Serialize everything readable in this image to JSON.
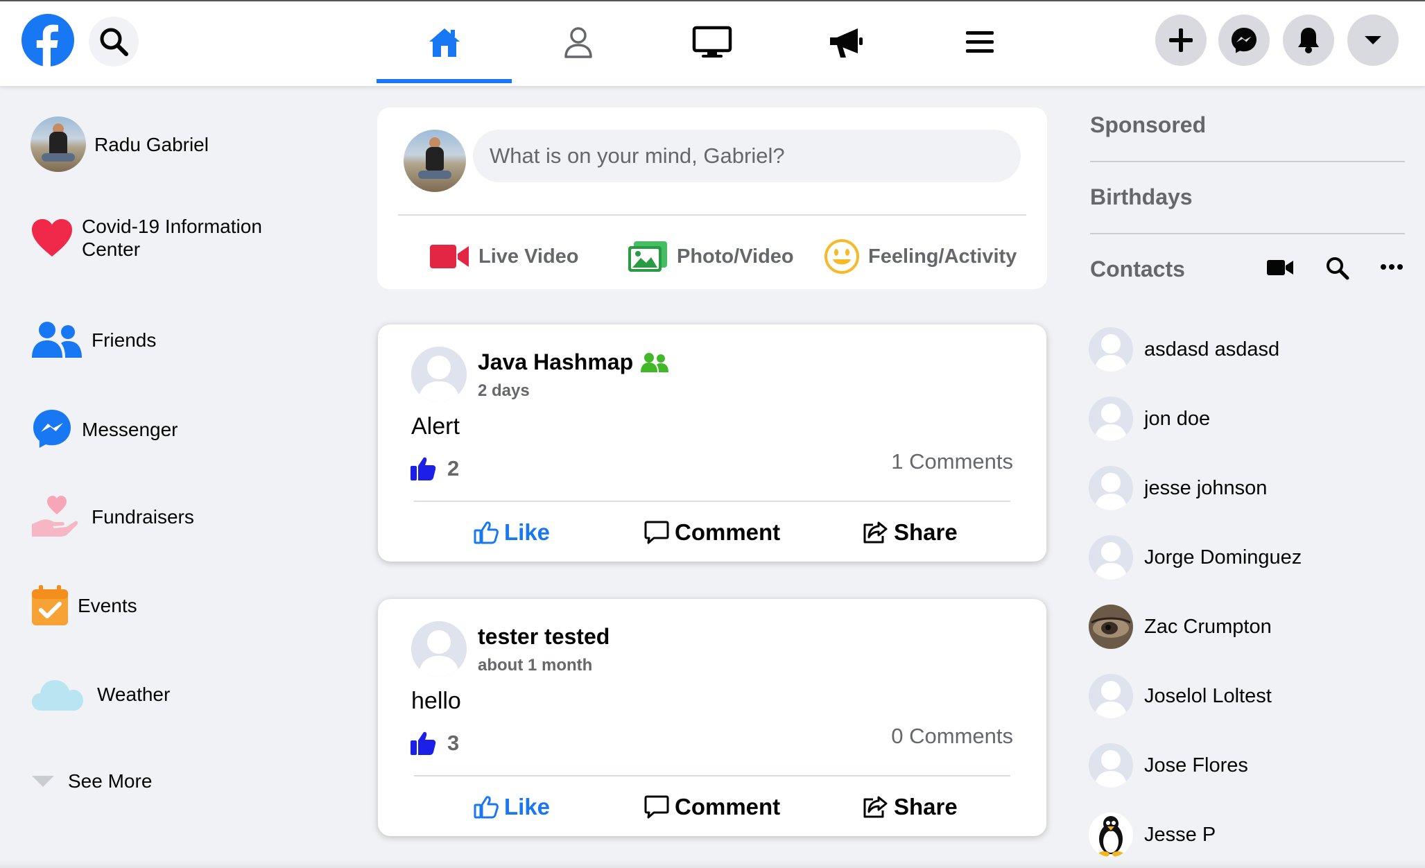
{
  "topbar": {
    "nav_tabs": [
      "home",
      "profile",
      "watch",
      "ads",
      "menu"
    ],
    "active_tab": "home",
    "actions": [
      "create",
      "messenger",
      "notifications",
      "account"
    ]
  },
  "left_sidebar": {
    "profile_name": "Radu Gabriel",
    "items": [
      {
        "label": "Covid-19 Information Center",
        "icon": "heart-icon"
      },
      {
        "label": "Friends",
        "icon": "friends-icon"
      },
      {
        "label": "Messenger",
        "icon": "messenger-icon"
      },
      {
        "label": "Fundraisers",
        "icon": "fundraiser-icon"
      },
      {
        "label": "Events",
        "icon": "calendar-icon"
      },
      {
        "label": "Weather",
        "icon": "cloud-icon"
      }
    ],
    "see_more": "See More"
  },
  "composer": {
    "placeholder": "What is on your mind, Gabriel?",
    "actions": [
      {
        "label": "Live Video",
        "icon": "video-camera-icon"
      },
      {
        "label": "Photo/Video",
        "icon": "photo-icon"
      },
      {
        "label": "Feeling/Activity",
        "icon": "smiley-icon"
      }
    ]
  },
  "posts": [
    {
      "author": "Java Hashmap",
      "time": "2 days",
      "text": "Alert",
      "likes": "2",
      "comments": "1 Comments",
      "actions": {
        "like": "Like",
        "comment": "Comment",
        "share": "Share"
      }
    },
    {
      "author": "tester tested",
      "time": "about 1 month",
      "text": "hello",
      "likes": "3",
      "comments": "0 Comments",
      "actions": {
        "like": "Like",
        "comment": "Comment",
        "share": "Share"
      }
    }
  ],
  "right_sidebar": {
    "sponsored": "Sponsored",
    "birthdays": "Birthdays",
    "contacts_title": "Contacts",
    "contacts": [
      "asdasd asdasd",
      "jon doe",
      "jesse johnson",
      "Jorge Dominguez",
      "Zac Crumpton",
      "Joselol Loltest",
      "Jose Flores",
      "Jesse P"
    ]
  },
  "colors": {
    "brand": "#1877f2",
    "background": "#f0f2f5",
    "secondary_text": "#65676b"
  }
}
